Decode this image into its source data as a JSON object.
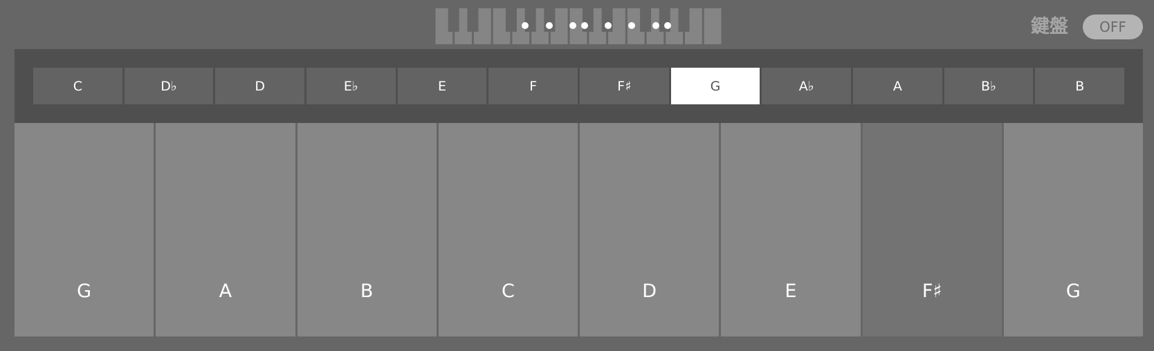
{
  "header": {
    "keyboard_label": "鍵盤",
    "toggle_label": "OFF"
  },
  "mini_keyboard": {
    "highlighted_keys": [
      4,
      5,
      6,
      7,
      8,
      9,
      10,
      11
    ]
  },
  "key_selector": {
    "selected": "G",
    "notes": [
      "C",
      "D♭",
      "D",
      "E♭",
      "E",
      "F",
      "F♯",
      "G",
      "A♭",
      "A",
      "B♭",
      "B"
    ]
  },
  "scale_keys": [
    {
      "label": "G",
      "accidental": false
    },
    {
      "label": "A",
      "accidental": false
    },
    {
      "label": "B",
      "accidental": false
    },
    {
      "label": "C",
      "accidental": false
    },
    {
      "label": "D",
      "accidental": false
    },
    {
      "label": "E",
      "accidental": false
    },
    {
      "label": "F♯",
      "accidental": true
    },
    {
      "label": "G",
      "accidental": false
    }
  ],
  "colors": {
    "background": "#666666",
    "panel": "#4f4f4f",
    "button": "#636363",
    "selected": "#ffffff",
    "key": "#878787",
    "accidental_key": "#737373"
  }
}
